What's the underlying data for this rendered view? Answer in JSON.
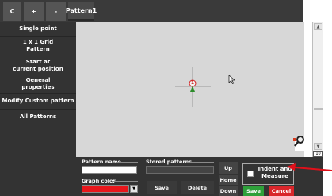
{
  "tabs": [
    {
      "label": "C"
    },
    {
      "label": "+"
    },
    {
      "label": "-"
    },
    {
      "label": "Pattern1"
    }
  ],
  "sidebar": {
    "items": [
      {
        "label": "Single point"
      },
      {
        "label": "1 x 1 Grid\nPattern"
      },
      {
        "label": "Start at\ncurrent position"
      },
      {
        "label": "General\nproperties"
      },
      {
        "label": "Modify Custom pattern"
      },
      {
        "label": "All Patterns"
      }
    ]
  },
  "canvas": {
    "marker_number": "1",
    "zoom_label": "10"
  },
  "bottom": {
    "pattern_name_label": "Pattern name",
    "pattern_name_value": "",
    "graph_color_label": "Graph color",
    "graph_color_hex": "#e8161b",
    "stored_patterns_label": "Stored patterns",
    "save_label": "Save",
    "delete_label": "Delete",
    "up_label": "Up",
    "home_label": "Home",
    "down_label": "Down",
    "indent_label": "Indent and\nMeasure",
    "save2_label": "Save",
    "cancel_label": "Cancel"
  },
  "colors": {
    "accent_green": "#2ea03a",
    "accent_red": "#d9262b",
    "arrow_red": "#e0101a"
  }
}
